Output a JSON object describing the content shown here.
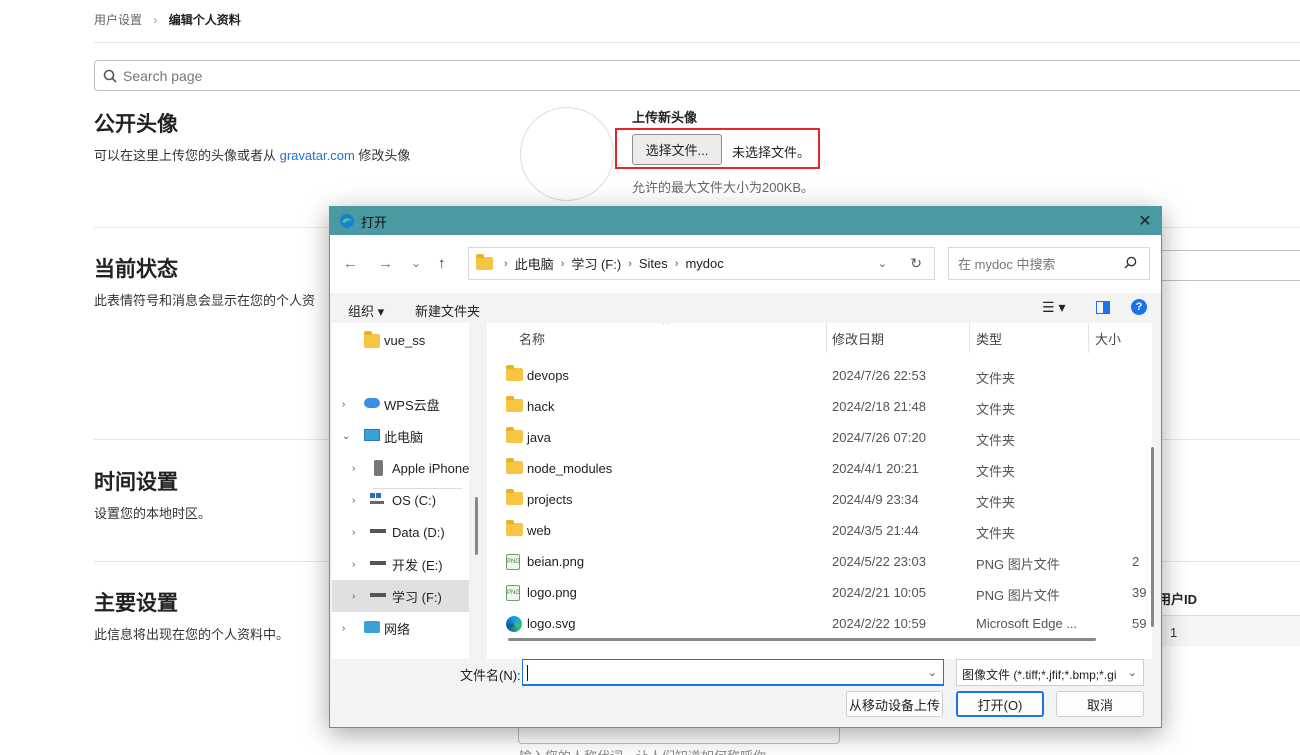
{
  "breadcrumb": {
    "parent": "用户设置",
    "separator": "›",
    "current": "编辑个人资料"
  },
  "search": {
    "placeholder": "Search page"
  },
  "sections": {
    "avatar": {
      "title": "公开头像",
      "desc_prefix": "可以在这里上传您的头像或者从 ",
      "desc_link": "gravatar.com",
      "desc_suffix": " 修改头像"
    },
    "status": {
      "title": "当前状态",
      "desc": "此表情符号和消息会显示在您的个人资"
    },
    "time": {
      "title": "时间设置",
      "desc": "设置您的本地时区。"
    },
    "main": {
      "title": "主要设置",
      "desc": "此信息将出现在您的个人资料中。"
    }
  },
  "upload": {
    "label": "上传新头像",
    "button": "选择文件...",
    "no_file": "未选择文件。",
    "limit": "允许的最大文件大小为200KB。"
  },
  "user_id": {
    "label": "用户ID",
    "value": "1"
  },
  "bottom_hint": "输入您的人称代词，让人们知道如何称呼你。",
  "dialog": {
    "title": "打开",
    "close": "✕",
    "nav": {
      "back": "←",
      "forward": "→",
      "recent": "⌄",
      "up": "↑"
    },
    "path": [
      "此电脑",
      "学习 (F:)",
      "Sites",
      "mydoc"
    ],
    "search_placeholder": "在 mydoc 中搜索",
    "toolbar": {
      "organize": "组织 ▾",
      "new_folder": "新建文件夹"
    },
    "tree": [
      {
        "label": "vue_ss",
        "icon": "folder-icon"
      },
      {
        "label": "WPS云盘",
        "icon": "cloud-icon"
      },
      {
        "label": "此电脑",
        "icon": "computer-icon"
      },
      {
        "label": "Apple iPhone",
        "icon": "phone-icon"
      },
      {
        "label": "OS (C:)",
        "icon": "windows-drive-icon"
      },
      {
        "label": "Data (D:)",
        "icon": "drive-icon"
      },
      {
        "label": "开发 (E:)",
        "icon": "drive-icon"
      },
      {
        "label": "学习 (F:)",
        "icon": "drive-icon"
      },
      {
        "label": "网络",
        "icon": "network-icon"
      }
    ],
    "columns": {
      "name": "名称",
      "date": "修改日期",
      "type": "类型",
      "size": "大小"
    },
    "files": [
      {
        "name": "devops",
        "date": "2024/7/26 22:53",
        "type": "文件夹",
        "size": "",
        "icon": "folder"
      },
      {
        "name": "hack",
        "date": "2024/2/18 21:48",
        "type": "文件夹",
        "size": "",
        "icon": "folder"
      },
      {
        "name": "java",
        "date": "2024/7/26 07:20",
        "type": "文件夹",
        "size": "",
        "icon": "folder"
      },
      {
        "name": "node_modules",
        "date": "2024/4/1 20:21",
        "type": "文件夹",
        "size": "",
        "icon": "folder"
      },
      {
        "name": "projects",
        "date": "2024/4/9 23:34",
        "type": "文件夹",
        "size": "",
        "icon": "folder"
      },
      {
        "name": "web",
        "date": "2024/3/5 21:44",
        "type": "文件夹",
        "size": "",
        "icon": "folder"
      },
      {
        "name": "beian.png",
        "date": "2024/5/22 23:03",
        "type": "PNG 图片文件",
        "size": "2",
        "icon": "png"
      },
      {
        "name": "logo.png",
        "date": "2024/2/21 10:05",
        "type": "PNG 图片文件",
        "size": "39",
        "icon": "png"
      },
      {
        "name": "logo.svg",
        "date": "2024/2/22 10:59",
        "type": "Microsoft Edge ...",
        "size": "59",
        "icon": "edge"
      }
    ],
    "filename_label": "文件名(N):",
    "filename_value": "",
    "filter": "图像文件 (*.tiff;*.jfif;*.bmp;*.gi",
    "buttons": {
      "upload_mobile": "从移动设备上传",
      "open": "打开(O)",
      "cancel": "取消"
    }
  },
  "colors": {
    "titlebar": "#4a9aa3",
    "highlight": "#e3262a",
    "link": "#1f75cb"
  }
}
